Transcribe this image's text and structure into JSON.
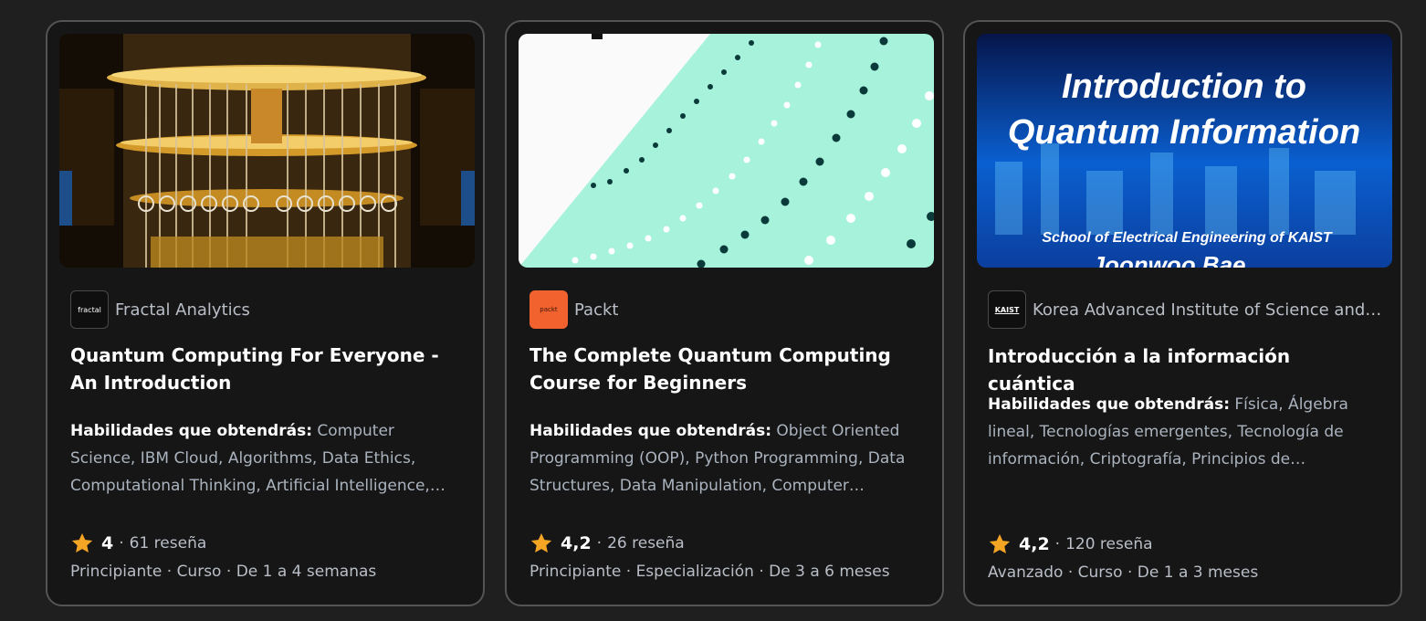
{
  "cards": [
    {
      "partner": "Fractal Analytics",
      "partner_logo_text": "fractal",
      "title": "Quantum Computing For Everyone - An Introduction",
      "skills_label": "Habilidades que obtendrás:",
      "skills": "Computer Science, IBM Cloud, Algorithms, Data Ethics, Computational Thinking, Artificial Intelligence, Machine Learning",
      "rating": "4",
      "reviews": "61 reseña",
      "level": "Principiante",
      "type": "Curso",
      "duration": "De 1 a 4 semanas",
      "icon": "quantum-computer-image"
    },
    {
      "partner": "Packt",
      "partner_logo_text": "packt",
      "title": "The Complete Quantum Computing Course for Beginners",
      "skills_label": "Habilidades que obtendrás:",
      "skills": "Object Oriented Programming (OOP), Python Programming, Data Structures, Data Manipulation, Computer Programming",
      "rating": "4,2",
      "reviews": "26 reseña",
      "level": "Principiante",
      "type": "Especialización",
      "duration": "De 3 a 6 meses",
      "icon": "dotted-lines-image"
    },
    {
      "partner": "Korea Advanced Institute of Science and Technology (KAIST)",
      "partner_logo_text": "KAIST",
      "title": "Introducción a la información cuántica",
      "skills_label": "Habilidades que obtendrás:",
      "skills": "Física, Álgebra lineal, Tecnologías emergentes, Tecnología de información, Criptografía, Principios de informática",
      "rating": "4,2",
      "reviews": "120 reseña",
      "level": "Avanzado",
      "type": "Curso",
      "duration": "De 1 a 3 meses",
      "thumb_title_1": "Introduction to",
      "thumb_title_2": "Quantum Information",
      "thumb_subtitle": "School of Electrical Engineering of KAIST",
      "thumb_name": "Joonwoo Bae"
    }
  ],
  "separator": "·",
  "colors": {
    "star": "#f5a524",
    "card_bg": "#161616",
    "border": "#545454"
  }
}
